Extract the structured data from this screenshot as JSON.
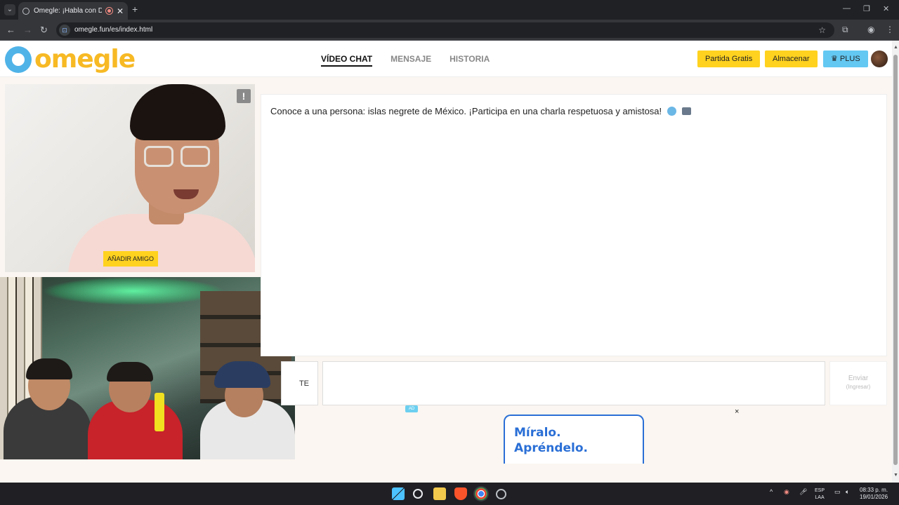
{
  "browser": {
    "tab_title": "Omegle: ¡Habla con Descon",
    "url": "omegle.fun/es/index.html"
  },
  "header": {
    "logo_text": "omegle",
    "nav": [
      {
        "label": "VÍDEO CHAT",
        "active": true
      },
      {
        "label": "MENSAJE",
        "active": false
      },
      {
        "label": "HISTORIA",
        "active": false
      }
    ],
    "buttons": {
      "partida": "Partida Gratis",
      "almacenar": "Almacenar",
      "plus": "♛ PLUS"
    }
  },
  "video": {
    "add_friend": "AÑADIR AMIGO",
    "report_icon": "!"
  },
  "chat": {
    "message": "Conoce a una persona: islas negrete de México. ¡Participa en una charla respetuosa y amistosa!",
    "skip_label": "TE",
    "send_label": "Enviar",
    "send_hint": "(Ingresar)"
  },
  "ad": {
    "badge": "AD",
    "line1": "Míralo.",
    "line2": "Apréndelo.",
    "close": "×"
  },
  "taskbar": {
    "lang1": "ESP",
    "lang2": "LAA",
    "time": "08:33 p. m.",
    "date": "19/01/2026"
  },
  "colors": {
    "accent_yellow": "#ffd21f",
    "plus_blue": "#63c8f2",
    "logo_blue": "#4fb3e8",
    "logo_yellow": "#f7b924"
  }
}
